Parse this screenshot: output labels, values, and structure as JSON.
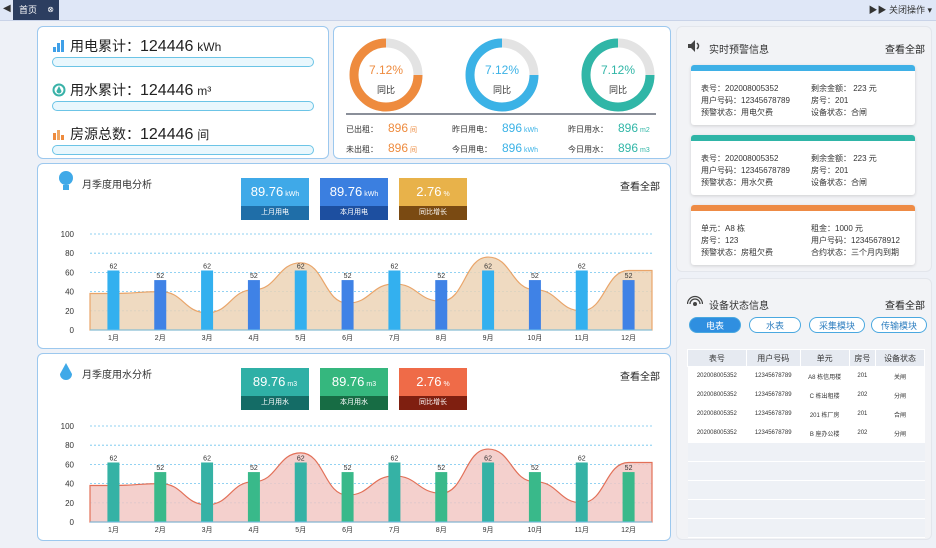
{
  "topbar": {
    "left_icon": "◀",
    "tab_label": "首页",
    "tab_close": "⊗",
    "right_label": "▶▶ 关闭操作 ▾"
  },
  "stats": [
    {
      "label": "用电累计：",
      "value": "124446",
      "unit": "kWh",
      "icon": "bar-chart-icon"
    },
    {
      "label": "用水累计：",
      "value": "124446",
      "unit": "m³",
      "icon": "water-icon"
    },
    {
      "label": "房源总数：",
      "value": "124446",
      "unit": "间",
      "icon": "building-icon"
    }
  ],
  "donuts": [
    {
      "pct": "7.12%",
      "label": "同比",
      "color": "#ee8b3e"
    },
    {
      "pct": "7.12%",
      "label": "同比",
      "color": "#3bb2e6"
    },
    {
      "pct": "7.12%",
      "label": "同比",
      "color": "#30b6a7"
    }
  ],
  "summary": [
    {
      "label": "已出租：",
      "value": "896",
      "unit": "间"
    },
    {
      "label": "昨日用电：",
      "value": "896",
      "unit": "kWh"
    },
    {
      "label": "昨日用水：",
      "value": "896",
      "unit": "m2"
    },
    {
      "label": "未出租：",
      "value": "896",
      "unit": "间"
    },
    {
      "label": "今日用电：",
      "value": "896",
      "unit": "kWh"
    },
    {
      "label": "今日用水：",
      "value": "896",
      "unit": "m3"
    }
  ],
  "elec": {
    "title": "月季度用电分析",
    "see_all": "查看全部",
    "kpis": [
      {
        "value": "89.76",
        "unit": "kWh",
        "label": "上月用电",
        "top": "#3fa9e8",
        "bot": "#1f6ea8"
      },
      {
        "value": "89.76",
        "unit": "kWh",
        "label": "本月用电",
        "top": "#3b7fe0",
        "bot": "#1d4fa0"
      },
      {
        "value": "2.76",
        "unit": "%",
        "label": "同比增长",
        "top": "#e8b24a",
        "bot": "#7a4a12"
      }
    ]
  },
  "water": {
    "title": "月季度用水分析",
    "see_all": "查看全部",
    "kpis": [
      {
        "value": "89.76",
        "unit": "m3",
        "label": "上月用水",
        "top": "#2fb0a6",
        "bot": "#146c66"
      },
      {
        "value": "89.76",
        "unit": "m3",
        "label": "本月用水",
        "top": "#35b77e",
        "bot": "#176c44"
      },
      {
        "value": "2.76",
        "unit": "%",
        "label": "同比增长",
        "top": "#ef6b48",
        "bot": "#7f1f10"
      }
    ]
  },
  "chart_data": [
    {
      "type": "bar",
      "categories": [
        "1月",
        "2月",
        "3月",
        "4月",
        "5月",
        "6月",
        "7月",
        "8月",
        "9月",
        "10月",
        "11月",
        "12月"
      ],
      "series": [
        {
          "values": [
            62,
            52,
            62,
            52,
            62,
            52,
            62,
            52,
            62,
            52,
            62,
            52
          ]
        }
      ],
      "area_values": [
        38,
        40,
        18,
        42,
        70,
        28,
        48,
        30,
        76,
        42,
        20,
        62
      ],
      "ylim": [
        0,
        100
      ],
      "yticks": [
        0,
        20,
        40,
        60,
        80,
        100
      ],
      "colors": {
        "odd": "#33b0ef",
        "even": "#3f82e6",
        "area_fill": "#ecd3b6",
        "area_line": "#e9a56a"
      }
    },
    {
      "type": "bar",
      "categories": [
        "1月",
        "2月",
        "3月",
        "4月",
        "5月",
        "6月",
        "7月",
        "8月",
        "9月",
        "10月",
        "11月",
        "12月"
      ],
      "series": [
        {
          "values": [
            62,
            52,
            62,
            52,
            62,
            52,
            62,
            52,
            62,
            52,
            62,
            52
          ]
        }
      ],
      "area_values": [
        38,
        40,
        18,
        42,
        72,
        28,
        48,
        30,
        76,
        42,
        20,
        62
      ],
      "ylim": [
        0,
        100
      ],
      "yticks": [
        0,
        20,
        40,
        60,
        80,
        100
      ],
      "colors": {
        "odd": "#35b2a5",
        "even": "#39b98a",
        "area_fill": "#f2c8c4",
        "area_line": "#e27058"
      }
    }
  ],
  "alerts": {
    "title": "实时预警信息",
    "see_all": "查看全部",
    "cards": [
      {
        "stripe": "#3fb0e6",
        "fields": [
          "表号：202008005352",
          "剩余金额：   223 元",
          "用户号码：12345678789",
          "房号：201",
          "预警状态：用电欠费",
          "设备状态：合闸"
        ]
      },
      {
        "stripe": "#2fb5a7",
        "fields": [
          "表号：202008005352",
          "剩余金额：   223 元",
          "用户号码：12345678789",
          "房号：201",
          "预警状态：用水欠费",
          "设备状态：合闸"
        ]
      },
      {
        "stripe": "#ee8b45",
        "fields": [
          "单元：A8 栋",
          "租金：1000 元",
          "房号：123",
          "用户号码：12345678912",
          "预警状态：房租欠费",
          "合约状态：三个月内到期"
        ]
      }
    ]
  },
  "devices": {
    "title": "设备状态信息",
    "see_all": "查看全部",
    "tabs": [
      "电表",
      "水表",
      "采集模块",
      "传输模块"
    ],
    "headers": [
      "表号",
      "用户号码",
      "单元",
      "房号",
      "设备状态"
    ],
    "rows": [
      [
        "202008005352",
        "12345678789",
        "A8 栋信用楼",
        "201",
        "关闸"
      ],
      [
        "202008005352",
        "12345678789",
        "C 栋出租楼",
        "202",
        "分闸"
      ],
      [
        "202008005352",
        "12345678789",
        "201 栋厂房",
        "201",
        "合闸"
      ],
      [
        "202008005352",
        "12345678789",
        "B 座办公楼",
        "202",
        "分闸"
      ]
    ]
  }
}
